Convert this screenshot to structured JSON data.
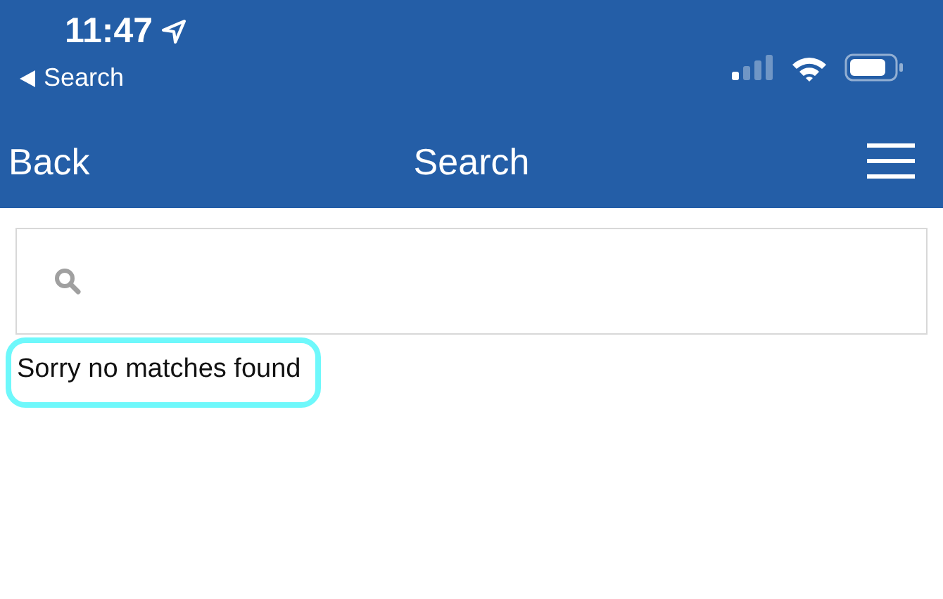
{
  "status_bar": {
    "time": "11:47",
    "back_app": "Search"
  },
  "nav_bar": {
    "back": "Back",
    "title": "Search"
  },
  "message": {
    "text": "Sorry no matches found",
    "highlighted": true
  }
}
